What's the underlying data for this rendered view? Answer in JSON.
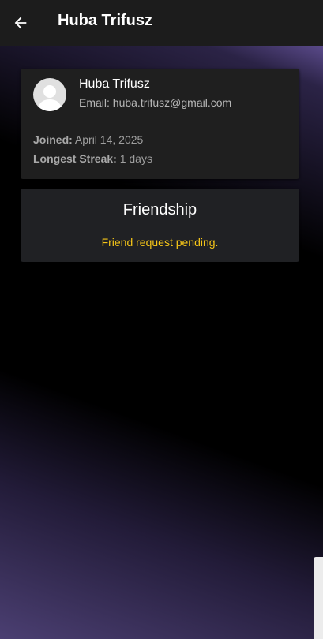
{
  "appbar": {
    "title": "Huba Trifusz"
  },
  "profile": {
    "name": "Huba Trifusz",
    "email": "Email: huba.trifusz@gmail.com",
    "joined_label": "Joined:",
    "joined_value": "April 14, 2025",
    "streak_label": "Longest Streak:",
    "streak_value": "1 days"
  },
  "friendship": {
    "title": "Friendship",
    "status": "Friend request pending."
  },
  "colors": {
    "appbar_bg": "#1c1c1c",
    "card_bg": "#1f1f1f",
    "status_yellow": "#f5c518",
    "gradient_purple": "#4b3f72"
  }
}
